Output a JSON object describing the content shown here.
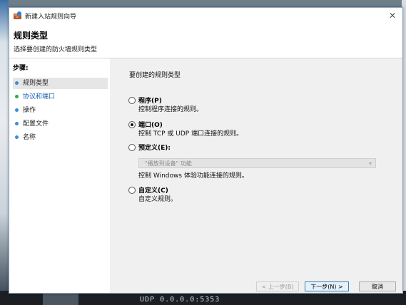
{
  "window": {
    "title": "新建入站规则向导",
    "close_glyph": "✕"
  },
  "header": {
    "title": "规则类型",
    "subtitle": "选择要创建的防火墙规则类型"
  },
  "sidebar": {
    "steps_label": "步骤:",
    "steps": [
      "规则类型",
      "协议和端口",
      "操作",
      "配置文件",
      "名称"
    ]
  },
  "main": {
    "question": "要创建的规则类型",
    "options": [
      {
        "label": "程序(P)",
        "desc": "控制程序连接的规则。",
        "checked": false
      },
      {
        "label": "端口(O)",
        "desc": "控制 TCP 或 UDP 端口连接的规则。",
        "checked": true
      },
      {
        "label": "预定义(E):",
        "desc": "控制 Windows 体验功能连接的规则。",
        "checked": false
      },
      {
        "label": "自定义(C)",
        "desc": "自定义规则。",
        "checked": false
      }
    ],
    "predefined_select_value": "\"播放到设备\" 功能"
  },
  "buttons": {
    "back": "< 上一步(B)",
    "next": "下一步(N) >",
    "cancel": "取消"
  },
  "background": {
    "taskbar_text": "UDP    0.0.0.0:5353"
  },
  "colors": {
    "link": "#1a5fb4",
    "primary_border": "#3c7fb1"
  }
}
